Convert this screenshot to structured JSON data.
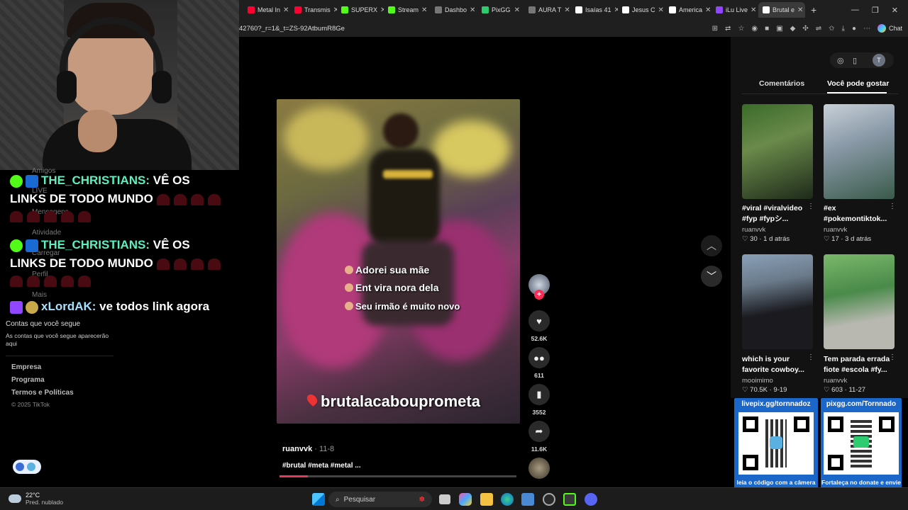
{
  "browser": {
    "tabs": [
      {
        "label": "Metal In",
        "color": "#ff0033"
      },
      {
        "label": "Transmis",
        "color": "#ff0033"
      },
      {
        "label": "SUPERX",
        "color": "#53fc18"
      },
      {
        "label": "Stream",
        "color": "#53fc18"
      },
      {
        "label": "Dashbo",
        "color": "#777777"
      },
      {
        "label": "PixGG",
        "color": "#2ecc71"
      },
      {
        "label": "AURA T",
        "color": "#777777"
      },
      {
        "label": "Isaías 41",
        "color": "#ffffff"
      },
      {
        "label": "Jesus C",
        "color": "#ffffff"
      },
      {
        "label": "America",
        "color": "#ffffff"
      },
      {
        "label": "iLu Live",
        "color": "#9146ff"
      },
      {
        "label": "Brutal e",
        "color": "#ffffff"
      }
    ],
    "url": "42760?_r=1&_t=ZS-92AtbumR8Ge",
    "chat_label": "Chat"
  },
  "stream_chat": {
    "messages": [
      {
        "user": "THE_CHRISTIANS:",
        "text": " VÊ OS",
        "text2": "LINKS DE TODO MUNDO"
      },
      {
        "user": "THE_CHRISTIANS:",
        "text": " VÊ OS",
        "text2": "LINKS DE TODO MUNDO"
      },
      {
        "user": "xLordAK:",
        "text": " ve todos link agora"
      }
    ],
    "ghost": [
      "Amigos",
      "LIVE",
      "Mensagens",
      "Atividade",
      "Carregar",
      "Perfil",
      "Mais"
    ]
  },
  "tiktok_sidebar": {
    "following_title": "Contas que você segue",
    "following_desc": "As contas que você segue aparecerão aqui",
    "links": [
      "Empresa",
      "Programa",
      "Termos e Políticas"
    ],
    "copyright": "© 2025 TikTok"
  },
  "video": {
    "captions": [
      "Adorei sua mãe",
      "Ent vira nora dela",
      "Seu irmão é muito novo"
    ],
    "location": "brutalacabouprometa",
    "author": "ruanvvk",
    "date": " · 11-8",
    "tags": "#brutal #meta #metal ...",
    "progress": 0.12,
    "likes": "52.6K",
    "comments": "611",
    "saves": "3552",
    "shares": "11.6K"
  },
  "related": {
    "tab_comments": "Comentários",
    "tab_like": "Você pode gostar",
    "items": [
      {
        "title": "#viral #viralvideo #fyp #fypシ...",
        "author": "ruanvvk",
        "meta": "♡ 30 · 1 d atrás"
      },
      {
        "title": "#ex #pokemontiktok...",
        "author": "ruanvvk",
        "meta": "♡ 17 · 3 d atrás"
      },
      {
        "title": "which is your favorite cowboy...",
        "author": "mooimimo",
        "meta": "♡ 70.5K · 9-19"
      },
      {
        "title": "Tem parada errada fiote #escola #fy...",
        "author": "ruanvvk",
        "meta": "♡ 603 · 11-27"
      }
    ]
  },
  "qr": [
    {
      "header": "livepix.gg/tornnadoz",
      "footer": "leia o código com a câmera do celular."
    },
    {
      "header": "pixgg.com/Tornnado",
      "footer": "Fortaleça no donate e envie sua mensagem!"
    }
  ],
  "taskbar": {
    "temp": "22°C",
    "weather": "Pred. nublado",
    "search": "Pesquisar"
  }
}
